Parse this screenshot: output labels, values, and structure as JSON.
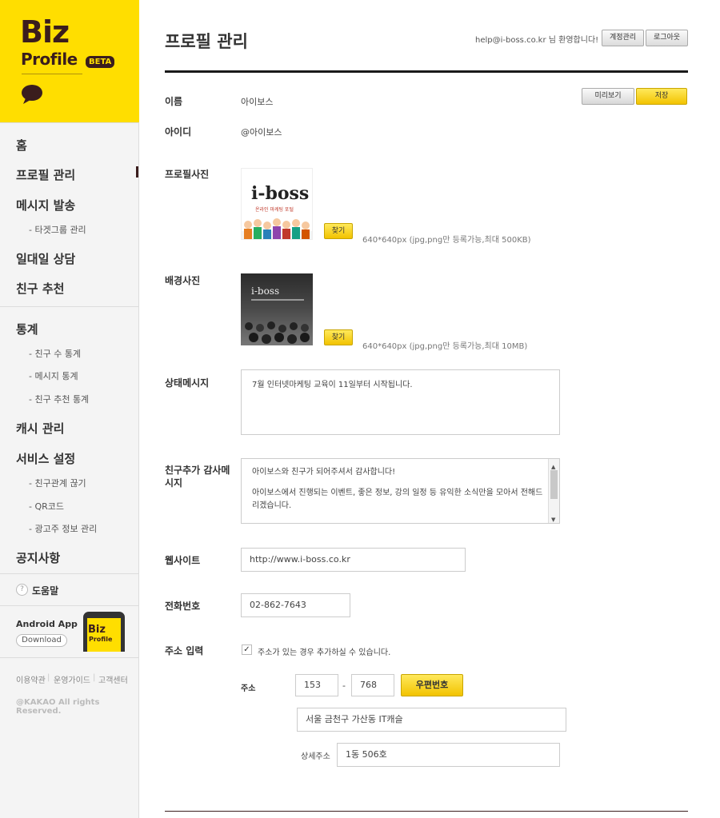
{
  "brand": {
    "logo_biz": "Biz",
    "logo_profile": "Profile",
    "badge": "BETA"
  },
  "sidebar": {
    "items": [
      {
        "label": "홈"
      },
      {
        "label": "프로필 관리"
      },
      {
        "label": "메시지 발송"
      },
      {
        "label": "- 타겟그룹 관리"
      },
      {
        "label": "일대일 상담"
      },
      {
        "label": "친구 추천"
      },
      {
        "label": "통계"
      },
      {
        "label": "- 친구 수 통계"
      },
      {
        "label": "- 메시지 통계"
      },
      {
        "label": "- 친구 추천 통계"
      },
      {
        "label": "캐시 관리"
      },
      {
        "label": "서비스 설정"
      },
      {
        "label": "- 친구관계 끊기"
      },
      {
        "label": "- QR코드"
      },
      {
        "label": "- 광고주 정보 관리"
      },
      {
        "label": "공지사항"
      }
    ],
    "active": "프로필 관리",
    "help": "도움말",
    "help_icon": "question-icon",
    "app_title": "Android App",
    "download": "Download",
    "phone_biz": "Biz",
    "phone_profile": "Profile",
    "footer_links": [
      "이용약관",
      "운영가이드",
      "고객센터"
    ],
    "copyright": "@KAKAO All rights Reserved."
  },
  "header": {
    "title": "프로필 관리",
    "welcome": "help@i-boss.co.kr 님 환영합니다!",
    "account_btn": "계정관리",
    "logout_btn": "로그아웃"
  },
  "form": {
    "preview_btn": "미리보기",
    "save_btn": "저장",
    "name_label": "이름",
    "name_value": "아이보스",
    "id_label": "아이디",
    "id_value": "@아이보스",
    "profile_photo_label": "프로필사진",
    "profile_photo_find": "찾기",
    "profile_photo_hint": "640*640px (jpg,png만 등록가능,최대 500KB)",
    "profile_img_logo": "i-boss",
    "profile_img_sub": "온라인 마케팅 포털",
    "bg_photo_label": "배경사진",
    "bg_photo_find": "찾기",
    "bg_photo_hint": "640*640px (jpg,png만 등록가능,최대 10MB)",
    "bg_img_logo": "i-boss",
    "status_label": "상태메시지",
    "status_value": "7월 인터넷마케팅 교육이 11일부터 시작됩니다.",
    "thanks_label": "친구추가 감사메시지",
    "thanks_line1": "아이보스와 친구가 되어주셔서 감사합니다!",
    "thanks_line2": "아이보스에서 진행되는 이벤트, 좋은 정보, 강의 일정 등 유익한 소식만을 모아서 전해드리겠습니다.",
    "website_label": "웹사이트",
    "website_value": "http://www.i-boss.co.kr",
    "phone_label": "전화번호",
    "phone_value": "02-862-7643",
    "address_input_label": "주소 입력",
    "address_checkbox_label": "주소가 있는 경우 추가하실 수 있습니다.",
    "address_checked": true,
    "address_label": "주소",
    "zip1": "153",
    "zip2": "768",
    "zip_dash": "-",
    "zip_btn": "우편번호",
    "address_value": "서울 금천구 가산동 IT캐슬",
    "detail_label": "상세주소",
    "detail_value": "1동 506호"
  },
  "colors": {
    "brand_yellow": "#ffde00",
    "brand_brown": "#3a1d1d",
    "button_yellow": "#f2c300"
  }
}
